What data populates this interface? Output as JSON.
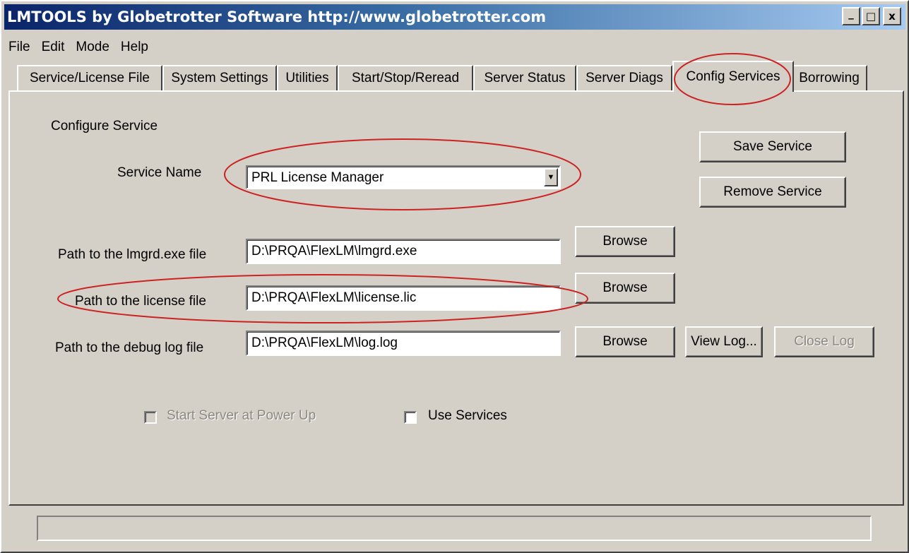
{
  "window": {
    "title": "LMTOOLS by Globetrotter Software http://www.globetrotter.com",
    "controls": {
      "minimize": "_",
      "maximize": "□",
      "close": "x"
    }
  },
  "menu": [
    "File",
    "Edit",
    "Mode",
    "Help"
  ],
  "tabs": [
    "Service/License File",
    "System Settings",
    "Utilities",
    "Start/Stop/Reread",
    "Server Status",
    "Server Diags",
    "Config Services",
    "Borrowing"
  ],
  "active_tab": "Config Services",
  "config": {
    "section_label": "Configure Service",
    "service_name_label": "Service Name",
    "service_name_value": "PRL License Manager",
    "lmgrd_label": "Path to the lmgrd.exe file",
    "lmgrd_value": "D:\\PRQA\\FlexLM\\lmgrd.exe",
    "license_label": "Path to the license file",
    "license_value": "D:\\PRQA\\FlexLM\\license.lic",
    "debug_label": "Path to the debug log file",
    "debug_value": "D:\\PRQA\\FlexLM\\log.log",
    "save_button": "Save Service",
    "remove_button": "Remove Service",
    "browse_button": "Browse",
    "view_log_button": "View Log...",
    "close_log_button": "Close Log",
    "start_power_up_label": "Start Server at Power Up",
    "use_services_label": "Use Services"
  },
  "annotation_color": "#cc2222"
}
